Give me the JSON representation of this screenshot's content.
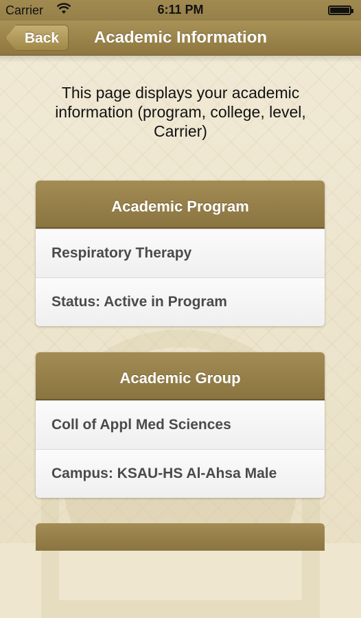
{
  "status_bar": {
    "carrier": "Carrier",
    "time": "6:11 PM",
    "wifi_icon": "wifi-icon",
    "battery_icon": "battery-icon"
  },
  "nav": {
    "back_label": "Back",
    "title": "Academic Information"
  },
  "intro_text": "This page displays your academic information (program, college, level, Carrier)",
  "sections": [
    {
      "header": "Academic Program",
      "rows": [
        "Respiratory Therapy",
        "Status:  Active in Program"
      ]
    },
    {
      "header": "Academic Group",
      "rows": [
        "Coll of Appl Med Sciences",
        "Campus:  KSAU-HS Al-Ahsa Male"
      ]
    }
  ],
  "colors": {
    "accent_gold": "#9a8348",
    "background": "#eee6cf"
  }
}
